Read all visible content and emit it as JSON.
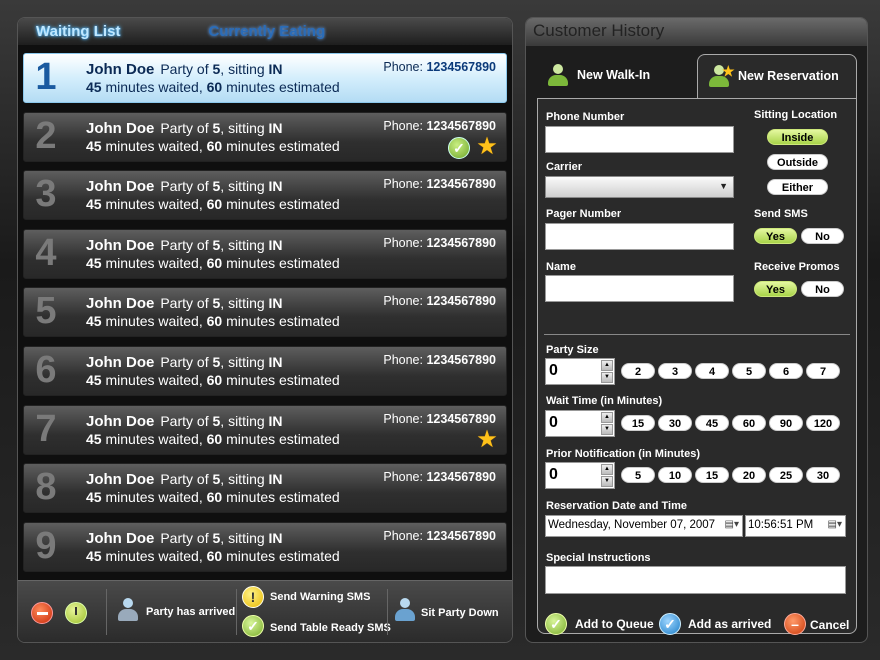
{
  "waiting_panel": {
    "tabs": [
      {
        "label": "Waiting List"
      },
      {
        "label": "Currently Eating"
      }
    ],
    "rows": [
      {
        "num": "1",
        "name": "John Doe",
        "party_prefix": "Party of",
        "party": "5",
        "sitting_prefix": "sitting",
        "sitting": "IN",
        "minutes_waited": "45",
        "waited_suffix": "minutes waited,",
        "minutes_estimated": "60",
        "estimated_suffix": "minutes estimated",
        "phone_label": "Phone:",
        "phone": "1234567890",
        "check": false,
        "star": false
      },
      {
        "num": "2",
        "name": "John Doe",
        "party_prefix": "Party of",
        "party": "5",
        "sitting_prefix": "sitting",
        "sitting": "IN",
        "minutes_waited": "45",
        "waited_suffix": "minutes waited,",
        "minutes_estimated": "60",
        "estimated_suffix": "minutes estimated",
        "phone_label": "Phone:",
        "phone": "1234567890",
        "check": true,
        "star": true
      },
      {
        "num": "3",
        "name": "John Doe",
        "party_prefix": "Party of",
        "party": "5",
        "sitting_prefix": "sitting",
        "sitting": "IN",
        "minutes_waited": "45",
        "waited_suffix": "minutes waited,",
        "minutes_estimated": "60",
        "estimated_suffix": "minutes estimated",
        "phone_label": "Phone:",
        "phone": "1234567890",
        "check": false,
        "star": false
      },
      {
        "num": "4",
        "name": "John Doe",
        "party_prefix": "Party of",
        "party": "5",
        "sitting_prefix": "sitting",
        "sitting": "IN",
        "minutes_waited": "45",
        "waited_suffix": "minutes waited,",
        "minutes_estimated": "60",
        "estimated_suffix": "minutes estimated",
        "phone_label": "Phone:",
        "phone": "1234567890",
        "check": false,
        "star": false
      },
      {
        "num": "5",
        "name": "John Doe",
        "party_prefix": "Party of",
        "party": "5",
        "sitting_prefix": "sitting",
        "sitting": "IN",
        "minutes_waited": "45",
        "waited_suffix": "minutes waited,",
        "minutes_estimated": "60",
        "estimated_suffix": "minutes estimated",
        "phone_label": "Phone:",
        "phone": "1234567890",
        "check": false,
        "star": false
      },
      {
        "num": "6",
        "name": "John Doe",
        "party_prefix": "Party of",
        "party": "5",
        "sitting_prefix": "sitting",
        "sitting": "IN",
        "minutes_waited": "45",
        "waited_suffix": "minutes waited,",
        "minutes_estimated": "60",
        "estimated_suffix": "minutes estimated",
        "phone_label": "Phone:",
        "phone": "1234567890",
        "check": false,
        "star": false
      },
      {
        "num": "7",
        "name": "John Doe",
        "party_prefix": "Party of",
        "party": "5",
        "sitting_prefix": "sitting",
        "sitting": "IN",
        "minutes_waited": "45",
        "waited_suffix": "minutes waited,",
        "minutes_estimated": "60",
        "estimated_suffix": "minutes estimated",
        "phone_label": "Phone:",
        "phone": "1234567890",
        "check": false,
        "star": true
      },
      {
        "num": "8",
        "name": "John Doe",
        "party_prefix": "Party of",
        "party": "5",
        "sitting_prefix": "sitting",
        "sitting": "IN",
        "minutes_waited": "45",
        "waited_suffix": "minutes waited,",
        "minutes_estimated": "60",
        "estimated_suffix": "minutes estimated",
        "phone_label": "Phone:",
        "phone": "1234567890",
        "check": false,
        "star": false
      },
      {
        "num": "9",
        "name": "John Doe",
        "party_prefix": "Party of",
        "party": "5",
        "sitting_prefix": "sitting",
        "sitting": "IN",
        "minutes_waited": "45",
        "waited_suffix": "minutes waited,",
        "minutes_estimated": "60",
        "estimated_suffix": "minutes estimated",
        "phone_label": "Phone:",
        "phone": "1234567890",
        "check": false,
        "star": false
      }
    ],
    "toolbar": {
      "remove_icon": "minus-circle-icon",
      "clock_icon": "clock-icon",
      "party_arrived": "Party has arrived",
      "send_warning": "Send Warning SMS",
      "send_ready": "Send Table Ready SMS",
      "sit_down": "Sit Party Down"
    }
  },
  "history_panel": {
    "title": "Customer History",
    "tabs": [
      {
        "label": "New Walk-In"
      },
      {
        "label": "New Reservation"
      }
    ],
    "form": {
      "phone_label": "Phone Number",
      "phone_value": "",
      "carrier_label": "Carrier",
      "carrier_value": "",
      "pager_label": "Pager Number",
      "pager_value": "",
      "name_label": "Name",
      "name_value": "",
      "sitting_label": "Sitting Location",
      "sitting_options": [
        "Inside",
        "Outside",
        "Either"
      ],
      "sitting_selected": "Inside",
      "sms_label": "Send SMS",
      "sms_yes": "Yes",
      "sms_no": "No",
      "sms_selected": "Yes",
      "promos_label": "Receive Promos",
      "promos_yes": "Yes",
      "promos_no": "No",
      "promos_selected": "Yes",
      "party_label": "Party Size",
      "party_value": "0",
      "party_quick": [
        "2",
        "3",
        "4",
        "5",
        "6",
        "7"
      ],
      "wait_label": "Wait Time (in Minutes)",
      "wait_value": "0",
      "wait_quick": [
        "15",
        "30",
        "45",
        "60",
        "90",
        "120"
      ],
      "notify_label": "Prior Notification (in Minutes)",
      "notify_value": "0",
      "notify_quick": [
        "5",
        "10",
        "15",
        "20",
        "25",
        "30"
      ],
      "date_label": "Reservation Date and Time",
      "date_value": "Wednesday, November 07, 2007",
      "time_value": "10:56:51 PM",
      "instructions_label": "Special Instructions",
      "instructions_value": "",
      "add_queue": "Add to Queue",
      "add_arrived": "Add as arrived",
      "cancel": "Cancel"
    }
  }
}
